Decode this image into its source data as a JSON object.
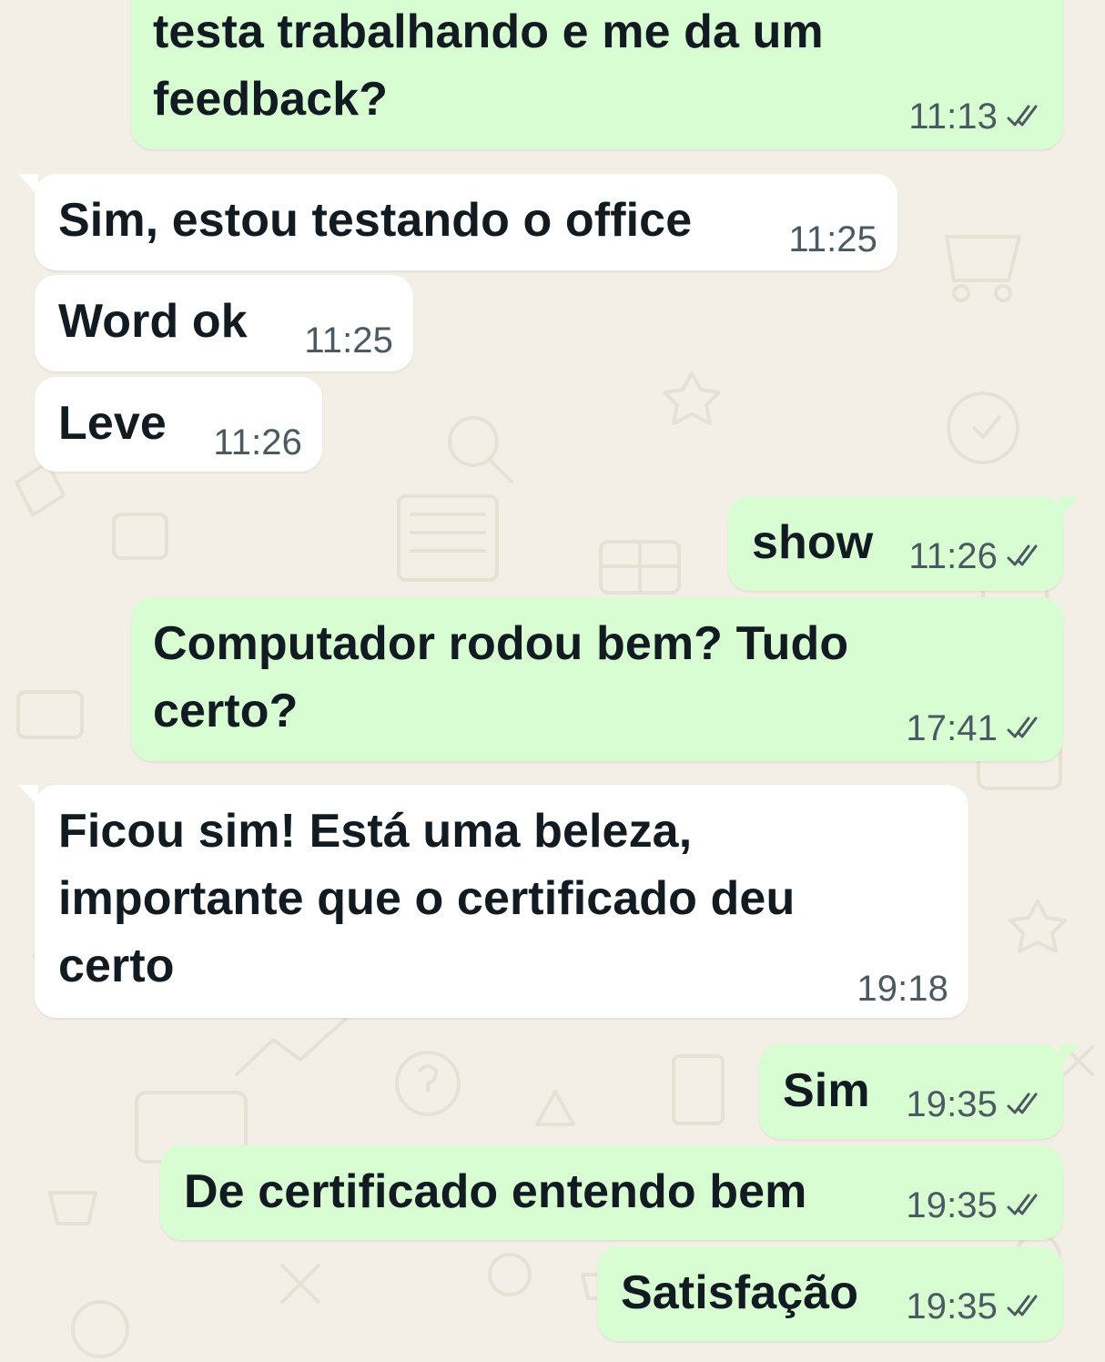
{
  "messages": [
    {
      "direction": "out",
      "text": "testa trabalhando e me da um\nfeedback?",
      "time": "11:13",
      "status": "read-check-icon"
    },
    {
      "direction": "in",
      "text": "Sim, estou testando o office",
      "time": "11:25"
    },
    {
      "direction": "in",
      "text": "Word ok",
      "time": "11:25"
    },
    {
      "direction": "in",
      "text": "Leve",
      "time": "11:26"
    },
    {
      "direction": "out",
      "text": "show",
      "time": "11:26",
      "status": "read-check-icon"
    },
    {
      "direction": "out",
      "text": "Computador rodou bem? Tudo\ncerto?",
      "time": "17:41",
      "status": "read-check-icon"
    },
    {
      "direction": "in",
      "text": "Ficou sim! Está uma beleza,\nimportante que o certificado deu\ncerto",
      "time": "19:18"
    },
    {
      "direction": "out",
      "text": "Sim",
      "time": "19:35",
      "status": "read-check-icon"
    },
    {
      "direction": "out",
      "text": "De certificado entendo bem",
      "time": "19:35",
      "status": "read-check-icon"
    },
    {
      "direction": "out",
      "text": "Satisfação",
      "time": "19:35",
      "status": "read-check-icon"
    }
  ],
  "colors": {
    "background": "#f3efe7",
    "outgoing_bubble": "#d9fdd3",
    "incoming_bubble": "#ffffff",
    "text": "#111b21",
    "meta_text": "#4b5a61",
    "doodle": "#ddd6c8"
  }
}
